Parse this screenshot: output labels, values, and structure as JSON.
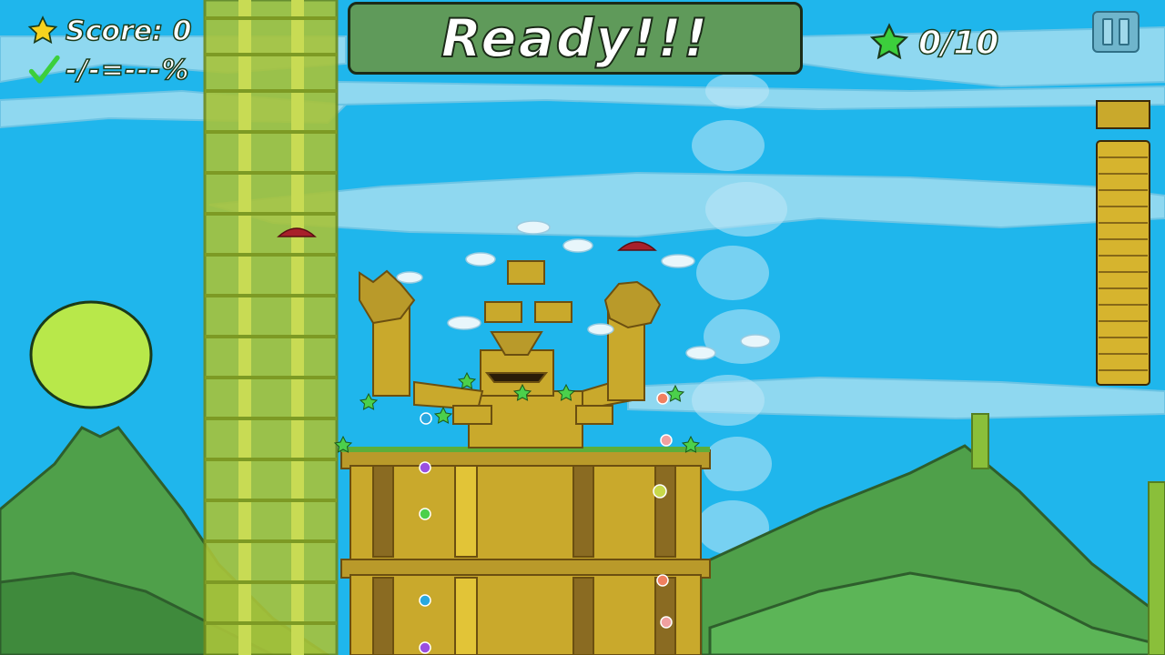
{
  "hud": {
    "score_label": "Score: 0",
    "accuracy_text": "-/-=---%",
    "banner_text": "Ready!!!",
    "stars_text": "0/10"
  },
  "icons": {
    "score": "yellow-star-icon",
    "accuracy": "checkmark-icon",
    "stars": "green-star-icon",
    "pause": "pause-icon"
  },
  "colors": {
    "sky": "#1fb6ec",
    "banner": "#5f9a5a",
    "brick": "#c9a92c",
    "hill": "#4fa04a",
    "moon": "#b8e84a"
  }
}
